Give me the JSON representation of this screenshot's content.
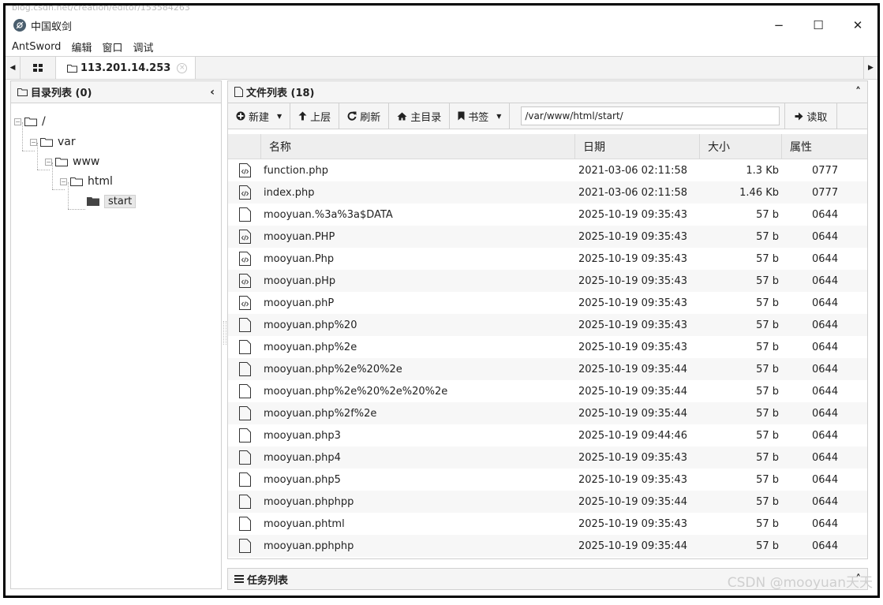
{
  "browser": {
    "url_fragment": "blog.csdn.net/creation/editor/153584263"
  },
  "window": {
    "title": "中国蚁剑",
    "minimize": "−",
    "maximize": "☐",
    "close": "✕"
  },
  "menu": {
    "items": [
      "AntSword",
      "编辑",
      "窗口",
      "调试"
    ]
  },
  "tabs": {
    "host": "113.201.14.253",
    "close_glyph": "×"
  },
  "directory": {
    "header": "目录列表 (0)",
    "collapse_glyph": "‹",
    "nodes": [
      "/",
      "var",
      "www",
      "html",
      "start"
    ]
  },
  "files": {
    "header": "文件列表 (18)",
    "collapse_glyph": "˄",
    "toolbar": {
      "new": "新建",
      "up": "上层",
      "refresh": "刷新",
      "home": "主目录",
      "bookmark": "书签",
      "path": "/var/www/html/start/",
      "read": "读取"
    },
    "columns": {
      "name": "名称",
      "date": "日期",
      "size": "大小",
      "attr": "属性"
    },
    "rows": [
      {
        "icon": "php-file-icon",
        "name": "function.php",
        "date": "2021-03-06 02:11:58",
        "size": "1.3 Kb",
        "attr": "0777"
      },
      {
        "icon": "php-file-icon",
        "name": "index.php",
        "date": "2021-03-06 02:11:58",
        "size": "1.46 Kb",
        "attr": "0777"
      },
      {
        "icon": "file-icon",
        "name": "mooyuan.%3a%3a$DATA",
        "date": "2025-10-19 09:35:43",
        "size": "57 b",
        "attr": "0644"
      },
      {
        "icon": "php-file-icon",
        "name": "mooyuan.PHP",
        "date": "2025-10-19 09:35:43",
        "size": "57 b",
        "attr": "0644"
      },
      {
        "icon": "php-file-icon",
        "name": "mooyuan.Php",
        "date": "2025-10-19 09:35:43",
        "size": "57 b",
        "attr": "0644"
      },
      {
        "icon": "php-file-icon",
        "name": "mooyuan.pHp",
        "date": "2025-10-19 09:35:43",
        "size": "57 b",
        "attr": "0644"
      },
      {
        "icon": "php-file-icon",
        "name": "mooyuan.phP",
        "date": "2025-10-19 09:35:43",
        "size": "57 b",
        "attr": "0644"
      },
      {
        "icon": "file-icon",
        "name": "mooyuan.php%20",
        "date": "2025-10-19 09:35:43",
        "size": "57 b",
        "attr": "0644"
      },
      {
        "icon": "file-icon",
        "name": "mooyuan.php%2e",
        "date": "2025-10-19 09:35:43",
        "size": "57 b",
        "attr": "0644"
      },
      {
        "icon": "file-icon",
        "name": "mooyuan.php%2e%20%2e",
        "date": "2025-10-19 09:35:44",
        "size": "57 b",
        "attr": "0644"
      },
      {
        "icon": "file-icon",
        "name": "mooyuan.php%2e%20%2e%20%2e",
        "date": "2025-10-19 09:35:44",
        "size": "57 b",
        "attr": "0644"
      },
      {
        "icon": "file-icon",
        "name": "mooyuan.php%2f%2e",
        "date": "2025-10-19 09:35:44",
        "size": "57 b",
        "attr": "0644"
      },
      {
        "icon": "file-icon",
        "name": "mooyuan.php3",
        "date": "2025-10-19 09:44:46",
        "size": "57 b",
        "attr": "0644"
      },
      {
        "icon": "file-icon",
        "name": "mooyuan.php4",
        "date": "2025-10-19 09:35:43",
        "size": "57 b",
        "attr": "0644"
      },
      {
        "icon": "file-icon",
        "name": "mooyuan.php5",
        "date": "2025-10-19 09:35:43",
        "size": "57 b",
        "attr": "0644"
      },
      {
        "icon": "file-icon",
        "name": "mooyuan.phphpp",
        "date": "2025-10-19 09:35:44",
        "size": "57 b",
        "attr": "0644"
      },
      {
        "icon": "file-icon",
        "name": "mooyuan.phtml",
        "date": "2025-10-19 09:35:43",
        "size": "57 b",
        "attr": "0644"
      },
      {
        "icon": "file-icon",
        "name": "mooyuan.pphphp",
        "date": "2025-10-19 09:35:44",
        "size": "57 b",
        "attr": "0644"
      }
    ]
  },
  "tasks": {
    "header": "任务列表",
    "collapse_glyph": "˄"
  },
  "watermark": "CSDN @mooyuan天天"
}
